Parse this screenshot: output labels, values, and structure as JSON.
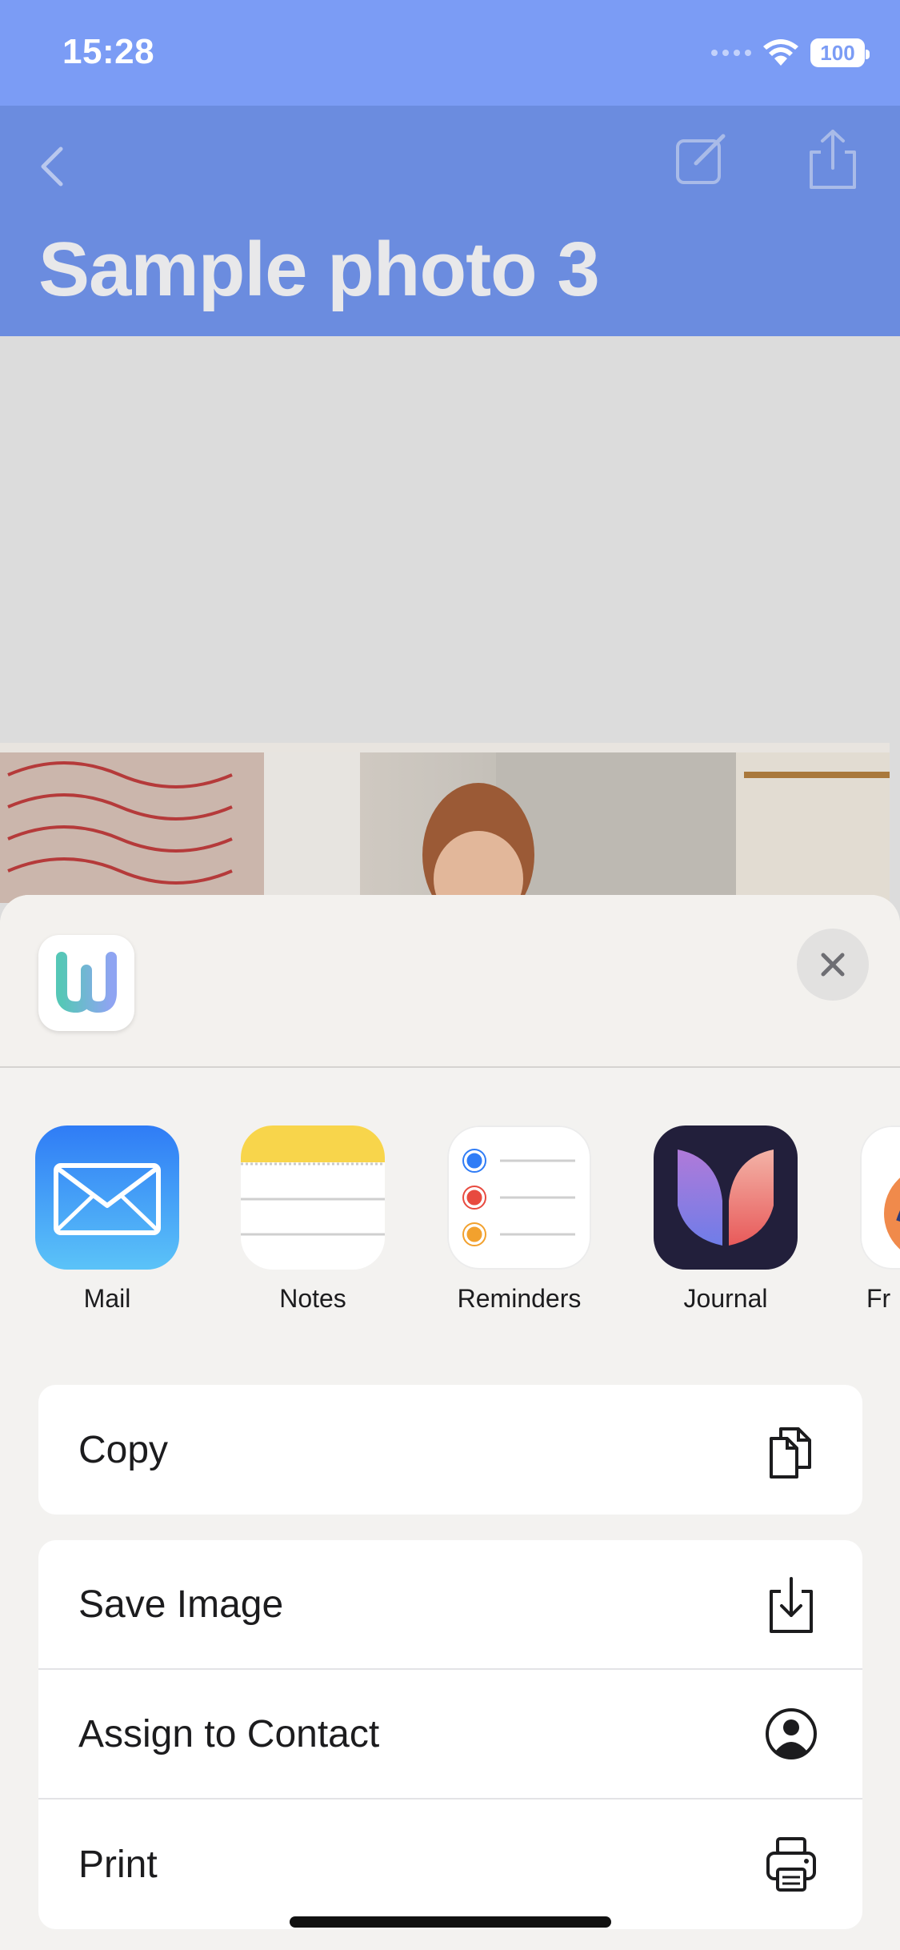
{
  "status_bar": {
    "time": "15:28",
    "battery": "100"
  },
  "nav": {
    "title": "Sample photo 3",
    "back_icon": "chevron-left-icon",
    "edit_icon": "compose-icon",
    "share_icon": "share-icon"
  },
  "share_sheet": {
    "app_icon": "w-app-icon",
    "close_icon": "close-icon",
    "apps": [
      {
        "label": "Mail",
        "icon": "mail-icon"
      },
      {
        "label": "Notes",
        "icon": "notes-icon"
      },
      {
        "label": "Reminders",
        "icon": "reminders-icon"
      },
      {
        "label": "Journal",
        "icon": "journal-icon"
      },
      {
        "label": "Fr",
        "icon": "freeform-icon"
      }
    ],
    "actions_group1": [
      {
        "label": "Copy",
        "icon": "copy-icon"
      }
    ],
    "actions_group2": [
      {
        "label": "Save Image",
        "icon": "save-icon"
      },
      {
        "label": "Assign to Contact",
        "icon": "contact-icon"
      },
      {
        "label": "Print",
        "icon": "print-icon"
      }
    ]
  },
  "colors": {
    "status_bg": "#7b9cf5",
    "nav_bg": "#6b8cdf",
    "sheet_bg": "#f3f2f0"
  }
}
